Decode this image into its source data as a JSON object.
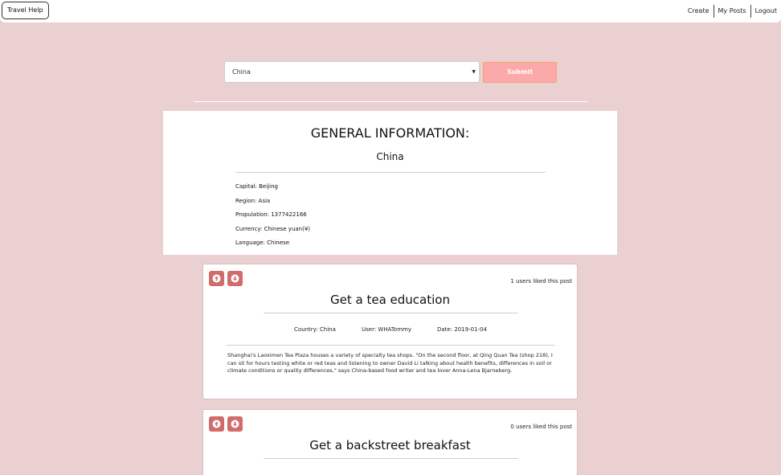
{
  "nav": {
    "brand": "Travel Help",
    "links": [
      "Create",
      "My Posts",
      "Logout"
    ]
  },
  "search": {
    "selected_country": "China",
    "submit_label": "Submit"
  },
  "info": {
    "heading": "GENERAL INFORMATION:",
    "country": "China",
    "capital": "Capital: Beijing",
    "region": "Region: Asia",
    "population": "Propulation: 1377422166",
    "currency": "Currency: Chinese yuan(¥)",
    "language": "Language: Chinese"
  },
  "posts": [
    {
      "likes_text": "1 users liked this post",
      "title": "Get a tea education",
      "country": "Country: China",
      "user": "User: WHATommy",
      "date": "Date: 2019-01-04",
      "body": "Shanghai's Laoximen Tea Plaza houses a variety of specialty tea shops. \"On the second floor, at Qing Quan Tea (shop 218), I can sit for hours testing white or red teas and listening to owner David Li talking about health benefits, differences in soil or climate conditions or quality differences,\" says China-based food writer and tea lover Anna-Lena Bjarneberg."
    },
    {
      "likes_text": "0 users liked this post",
      "title": "Get a backstreet breakfast"
    }
  ],
  "colors": {
    "page_bg": "#ead0d0",
    "submit_bg": "#fca9a9",
    "vote_button": "#d26b6b"
  },
  "icons": {
    "upvote": "arrow-up-circle-icon",
    "downvote": "arrow-down-circle-icon"
  }
}
